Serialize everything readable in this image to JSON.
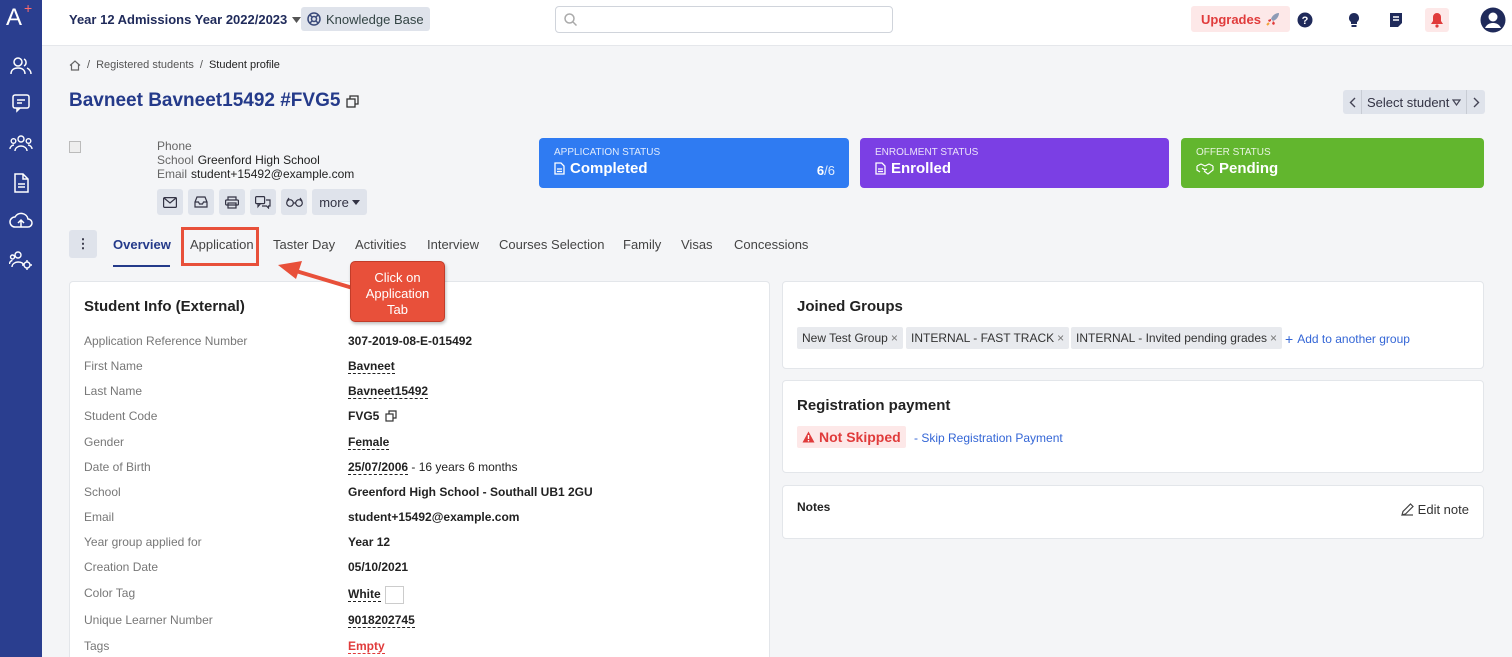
{
  "topbar": {
    "year_label": "Year 12 Admissions Year 2022/2023",
    "kb_label": "Knowledge Base",
    "search_placeholder": "",
    "upgrades_label": "Upgrades"
  },
  "breadcrumb": {
    "parent": "Registered students",
    "separator": "/",
    "current": "Student profile"
  },
  "student": {
    "name": "Bavneet Bavneet15492 #FVG5"
  },
  "select_student_label": "Select student",
  "contact": {
    "phone_label": "Phone",
    "phone_value": "",
    "school_label": "School",
    "school_value": "Greenford High School",
    "email_label": "Email",
    "email_value": "student+15492@example.com"
  },
  "more_label": "more",
  "status": {
    "application": {
      "label": "APPLICATION STATUS",
      "value": "Completed",
      "count": "6",
      "total": "/6",
      "color": "#2f7bf2"
    },
    "enrolment": {
      "label": "ENROLMENT STATUS",
      "value": "Enrolled",
      "color": "#7b3fe4"
    },
    "offer": {
      "label": "OFFER STATUS",
      "value": "Pending",
      "color": "#62b62e"
    }
  },
  "tabs": [
    "Overview",
    "Application",
    "Taster Day",
    "Activities",
    "Interview",
    "Courses Selection",
    "Family",
    "Visas",
    "Concessions"
  ],
  "callout": {
    "line1": "Click on",
    "line2": "Application",
    "line3": "Tab"
  },
  "student_info": {
    "title": "Student Info (External)",
    "rows": [
      {
        "k": "Application Reference Number",
        "v": "307-2019-08-E-015492"
      },
      {
        "k": "First Name",
        "v": "Bavneet"
      },
      {
        "k": "Last Name",
        "v": "Bavneet15492"
      },
      {
        "k": "Student Code",
        "v": "FVG5"
      },
      {
        "k": "Gender",
        "v": "Female"
      },
      {
        "k": "Date of Birth",
        "v": "25/07/2006",
        "extra": " - 16 years 6 months"
      },
      {
        "k": "School",
        "v": "Greenford High School - Southall UB1 2GU"
      },
      {
        "k": "Email",
        "v": "student+15492@example.com"
      },
      {
        "k": "Year group applied for",
        "v": "Year 12"
      },
      {
        "k": "Creation Date",
        "v": "05/10/2021"
      },
      {
        "k": "Color Tag",
        "v": "White"
      },
      {
        "k": "Unique Learner Number",
        "v": "9018202745"
      },
      {
        "k": "Tags",
        "v": "Empty"
      }
    ]
  },
  "groups": {
    "title": "Joined Groups",
    "chips": [
      "New Test Group",
      "INTERNAL - FAST TRACK",
      "INTERNAL - Invited pending grades"
    ],
    "add_label": "Add to another group"
  },
  "registration": {
    "title": "Registration payment",
    "status": "Not Skipped",
    "skip_link": "- Skip Registration Payment"
  },
  "notes": {
    "title": "Notes",
    "edit_label": "Edit note"
  }
}
